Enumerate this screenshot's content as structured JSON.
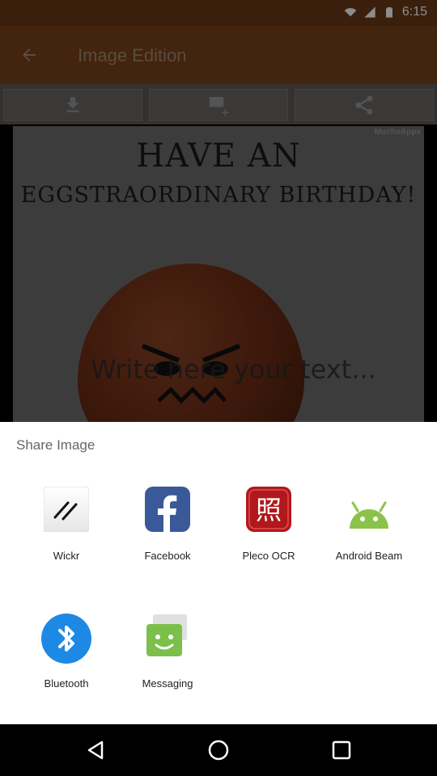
{
  "status_bar": {
    "time": "6:15"
  },
  "app_bar": {
    "title": "Image Edition"
  },
  "canvas": {
    "watermark": "MuchoApps",
    "headline_line1": "HAVE AN",
    "headline_line2": "EGGSTRAORDINARY BIRTHDAY!",
    "text_placeholder": "Write here your text..."
  },
  "share_sheet": {
    "title": "Share Image",
    "apps": [
      {
        "label": "Wickr",
        "icon": "wickr-icon"
      },
      {
        "label": "Facebook",
        "icon": "facebook-icon"
      },
      {
        "label": "Pleco OCR",
        "icon": "pleco-ocr-icon"
      },
      {
        "label": "Android Beam",
        "icon": "android-beam-icon"
      },
      {
        "label": "Bluetooth",
        "icon": "bluetooth-icon"
      },
      {
        "label": "Messaging",
        "icon": "messaging-icon"
      }
    ]
  },
  "nav_bar": {
    "icons": [
      "back-icon",
      "home-icon",
      "recents-icon"
    ]
  },
  "colors": {
    "app_bar": "#7a431a",
    "facebook": "#3b5998",
    "pleco": "#b0181c",
    "android": "#8bc34a",
    "bluetooth": "#1e88e5",
    "messaging": "#7cc04b"
  }
}
